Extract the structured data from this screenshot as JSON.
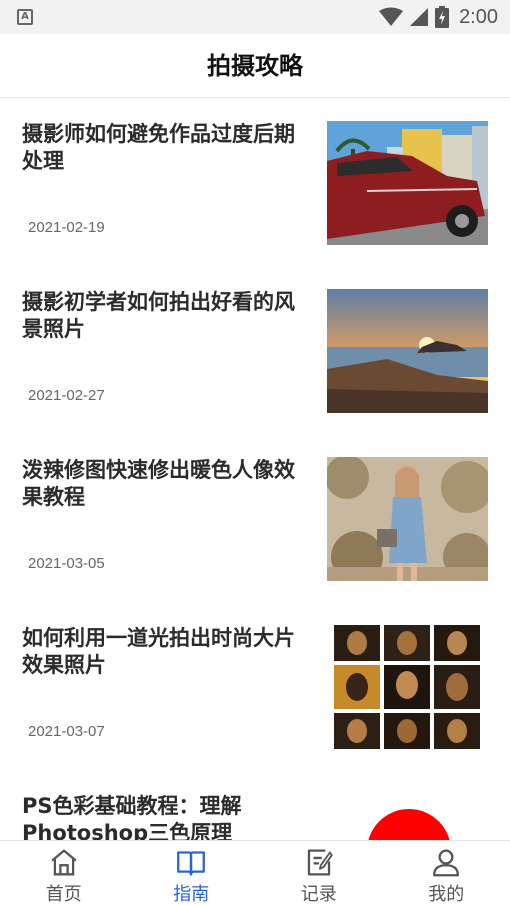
{
  "status_bar": {
    "time": "2:00",
    "app_icon_letter": "A",
    "icons": [
      "notification-app-icon",
      "wifi-icon",
      "cellular-signal-icon",
      "battery-charging-icon"
    ]
  },
  "header": {
    "title": "拍摄攻略"
  },
  "articles": [
    {
      "title": "摄影师如何避免作品过度后期处理",
      "date": "2021-02-19",
      "thumbnail": "red-classic-car-photo"
    },
    {
      "title": "摄影初学者如何拍出好看的风景照片",
      "date": "2021-02-27",
      "thumbnail": "sunset-seascape-photo"
    },
    {
      "title": "泼辣修图快速修出暖色人像效果教程",
      "date": "2021-03-05",
      "thumbnail": "warm-tone-portrait-photo"
    },
    {
      "title": "如何利用一道光拍出时尚大片效果照片",
      "date": "2021-03-07",
      "thumbnail": "light-beam-portrait-grid"
    },
    {
      "title": "PS色彩基础教程：理解Photoshop三色原理",
      "date": "",
      "thumbnail": "rgb-color-circles"
    }
  ],
  "tab_bar": {
    "active_color": "#2a63d8",
    "inactive_color": "#555555",
    "tabs": [
      {
        "label": "首页",
        "icon": "home-icon",
        "active": false
      },
      {
        "label": "指南",
        "icon": "book-icon",
        "active": true
      },
      {
        "label": "记录",
        "icon": "edit-note-icon",
        "active": false
      },
      {
        "label": "我的",
        "icon": "user-icon",
        "active": false
      }
    ]
  }
}
